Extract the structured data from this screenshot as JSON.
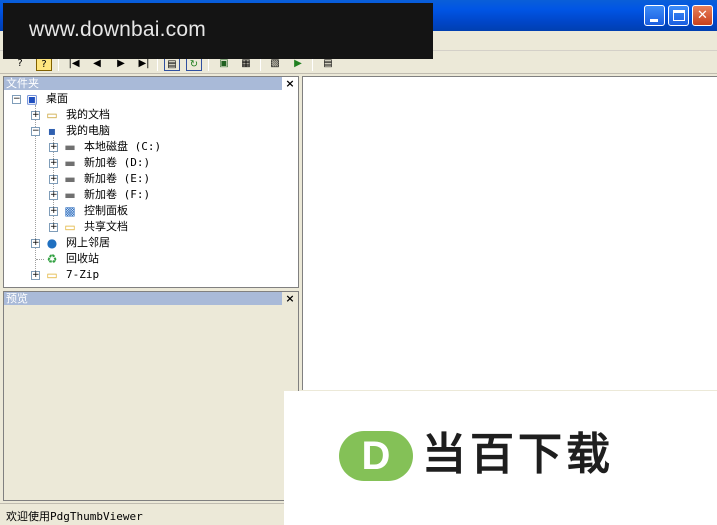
{
  "watermark": {
    "top_text": "www.downbai.com",
    "logo_letter": "D",
    "logo_text": "当百下载"
  },
  "panes": {
    "folders_header": "文件夹",
    "preview_header": "预览",
    "close_glyph": "×"
  },
  "tree": {
    "desktop": "桌面",
    "my_documents": "我的文档",
    "my_computer": "我的电脑",
    "local_c": "本地磁盘 (C:)",
    "new_d": "新加卷 (D:)",
    "new_e": "新加卷 (E:)",
    "new_f": "新加卷 (F:)",
    "control_panel": "控制面板",
    "shared_docs": "共享文档",
    "network": "网上邻居",
    "recycle_bin": "回收站",
    "seven_zip": "7-Zip"
  },
  "status": {
    "text": "欢迎使用PdgThumbViewer"
  },
  "icons": [
    "help-icon",
    "context-help-icon",
    "first-page-icon",
    "prev-page-icon",
    "next-page-icon",
    "last-page-icon",
    "view-icon",
    "refresh-icon",
    "copy-icon",
    "settings-icon",
    "export-icon",
    "run-icon",
    "properties-icon"
  ]
}
